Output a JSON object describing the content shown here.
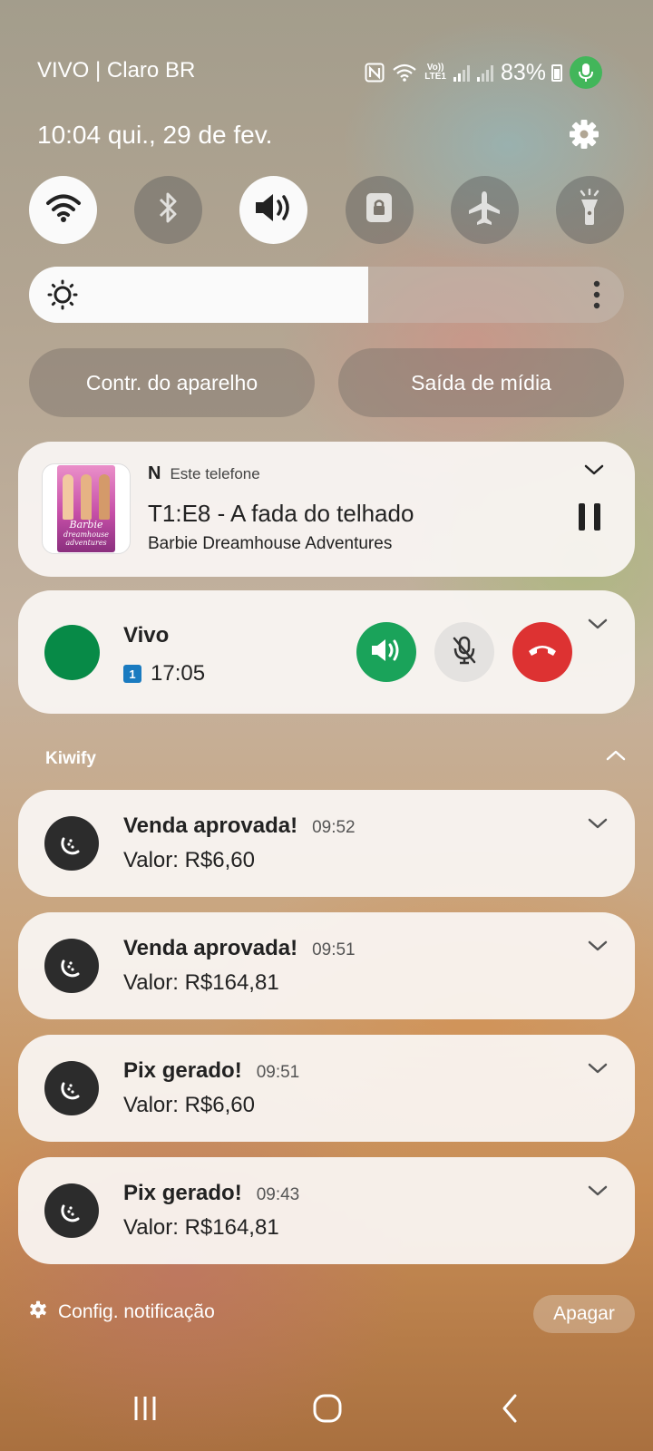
{
  "statusbar": {
    "carrier": "VIVO | Claro BR",
    "volte_top": "Vo))",
    "volte_bottom": "LTE1",
    "battery": "83%",
    "mic_active_color": "#42b65a"
  },
  "header": {
    "time_date": "10:04  qui., 29 de fev.",
    "settings_icon": "gear-icon"
  },
  "quick_settings": [
    {
      "name": "wifi",
      "icon": "wifi-icon",
      "on": true
    },
    {
      "name": "bluetooth",
      "icon": "bluetooth-icon",
      "on": false
    },
    {
      "name": "sound",
      "icon": "speaker-icon",
      "on": true
    },
    {
      "name": "rotation-lock",
      "icon": "lock-icon",
      "on": false
    },
    {
      "name": "airplane",
      "icon": "airplane-icon",
      "on": false
    },
    {
      "name": "flashlight",
      "icon": "flashlight-icon",
      "on": false
    }
  ],
  "brightness": {
    "level": 0.57
  },
  "pills": {
    "device_control": "Contr. do aparelho",
    "media_output": "Saída de mídia"
  },
  "media": {
    "app_badge": "N",
    "source": "Este telefone",
    "title": "T1:E8 - A fada do telhado",
    "subtitle": "Barbie Dreamhouse Adventures",
    "art_text_1": "Barbie",
    "art_text_2": "dreamhouse",
    "art_text_3": "adventures"
  },
  "call": {
    "name": "Vivo",
    "sim": "1",
    "duration": "17:05",
    "avatar_color": "#078a47",
    "speaker_color": "#1aa35a",
    "end_color": "#dd3232"
  },
  "group": {
    "name": "Kiwify"
  },
  "notifications": [
    {
      "title": "Venda aprovada!",
      "time": "09:52",
      "body": "Valor: R$6,60"
    },
    {
      "title": "Venda aprovada!",
      "time": "09:51",
      "body": "Valor: R$164,81"
    },
    {
      "title": "Pix gerado!",
      "time": "09:51",
      "body": "Valor: R$6,60"
    },
    {
      "title": "Pix gerado!",
      "time": "09:43",
      "body": "Valor: R$164,81"
    }
  ],
  "footer": {
    "settings_label": "Config. notificação",
    "clear_label": "Apagar"
  },
  "navbar": {
    "recents_icon": "recents-icon",
    "home_icon": "home-icon",
    "back_icon": "back-icon"
  }
}
